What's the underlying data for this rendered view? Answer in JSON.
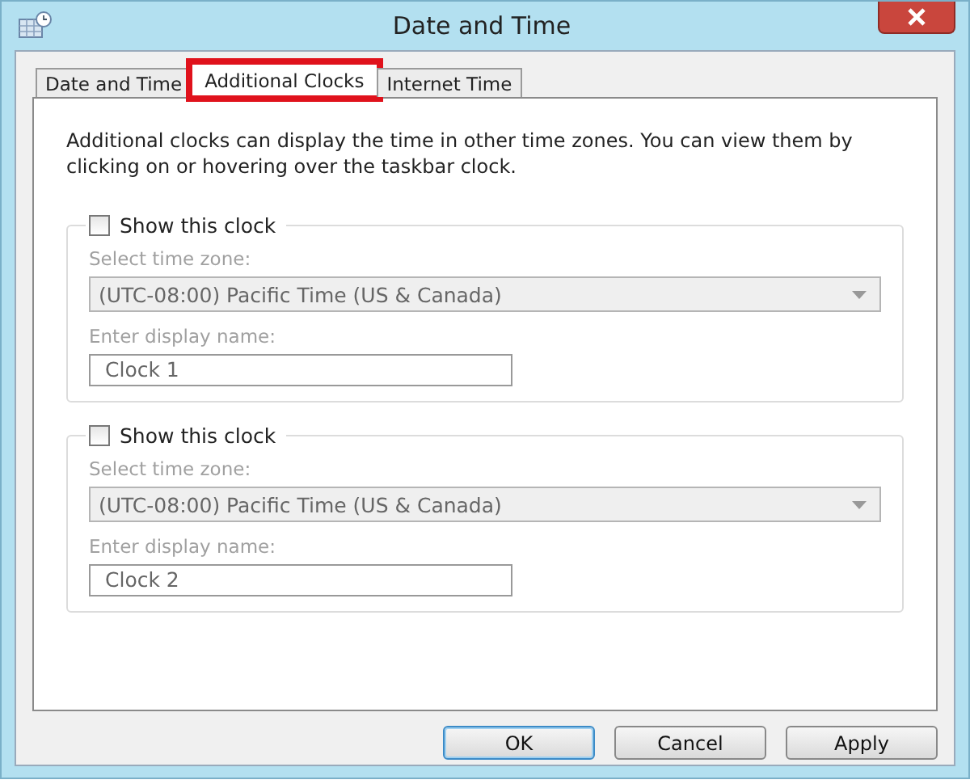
{
  "window": {
    "title": "Date and Time"
  },
  "tabs": [
    {
      "label": "Date and Time",
      "selected": false,
      "highlighted": false
    },
    {
      "label": "Additional Clocks",
      "selected": true,
      "highlighted": true
    },
    {
      "label": "Internet Time",
      "selected": false,
      "highlighted": false
    }
  ],
  "description": "Additional clocks can display the time in other time zones. You can view them by clicking on or hovering over the taskbar clock.",
  "clocks": [
    {
      "checkbox_label": "Show this clock",
      "checked": false,
      "timezone_label": "Select time zone:",
      "timezone": "(UTC-08:00) Pacific Time (US & Canada)",
      "name_label": "Enter display name:",
      "name": "Clock 1"
    },
    {
      "checkbox_label": "Show this clock",
      "checked": false,
      "timezone_label": "Select time zone:",
      "timezone": "(UTC-08:00) Pacific Time (US & Canada)",
      "name_label": "Enter display name:",
      "name": "Clock 2"
    }
  ],
  "buttons": [
    {
      "label": "OK",
      "default": true
    },
    {
      "label": "Cancel",
      "default": false
    },
    {
      "label": "Apply",
      "default": false
    }
  ]
}
